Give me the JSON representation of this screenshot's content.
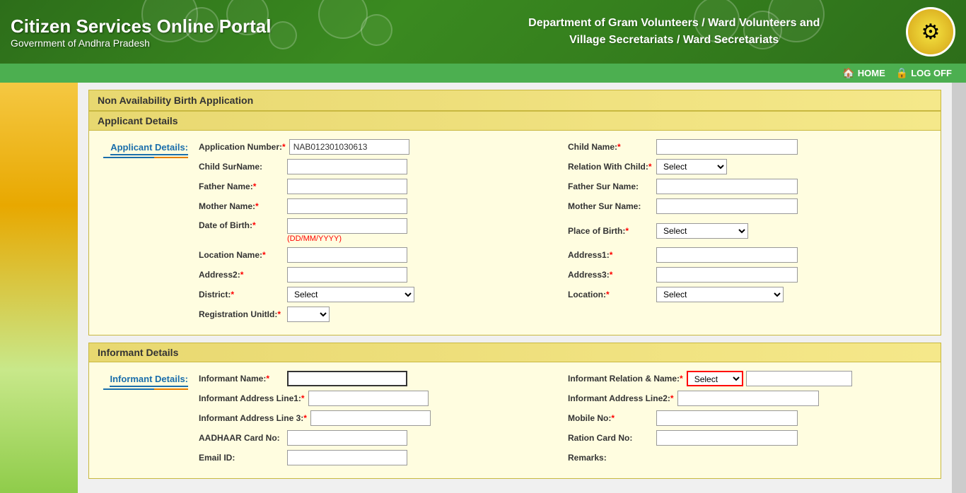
{
  "header": {
    "title": "Citizen Services Online Portal",
    "subtitle": "Government of Andhra Pradesh",
    "dept_name": "Department of Gram Volunteers / Ward Volunteers and\nVillage Secretariats / Ward Secretariats",
    "logo_symbol": "🏛"
  },
  "navbar": {
    "home_label": "HOME",
    "logoff_label": "LOG OFF",
    "home_icon": "🏠",
    "logoff_icon": "🔒"
  },
  "page_title": "Non Availability Birth Application",
  "applicant_details": {
    "section_title": "Applicant Details",
    "label_title": "Applicant Details:",
    "fields": {
      "application_number_label": "Application Number:",
      "application_number_value": "NAB012301030613",
      "child_name_label": "Child Name:",
      "child_surname_label": "Child SurName:",
      "relation_with_child_label": "Relation With Child:",
      "father_name_label": "Father Name:",
      "father_surname_label": "Father Sur Name:",
      "mother_name_label": "Mother Name:",
      "mother_surname_label": "Mother Sur Name:",
      "dob_label": "Date of Birth:",
      "dob_hint": "(DD/MM/YYYY)",
      "place_of_birth_label": "Place of Birth:",
      "location_name_label": "Location Name:",
      "address1_label": "Address1:",
      "address2_label": "Address2:",
      "address3_label": "Address3:",
      "district_label": "District:",
      "location_label": "Location:",
      "registration_unitid_label": "Registration UnitId:",
      "select_placeholder": "Select",
      "district_placeholder": "Select",
      "location_placeholder": "Select"
    }
  },
  "informant_details": {
    "section_title": "Informant Details",
    "label_title": "Informant Details:",
    "fields": {
      "informant_name_label": "Informant Name:",
      "informant_relation_label": "Informant Relation & Name:",
      "informant_addr1_label": "Informant Address Line1:",
      "informant_addr2_label": "Informant Address Line2:",
      "informant_addr3_label": "Informant Address Line 3:",
      "mobile_no_label": "Mobile No:",
      "aadhaar_label": "AADHAAR Card No:",
      "ration_card_label": "Ration Card No:",
      "email_label": "Email ID:",
      "remarks_label": "Remarks:",
      "select_placeholder": "Select"
    }
  }
}
